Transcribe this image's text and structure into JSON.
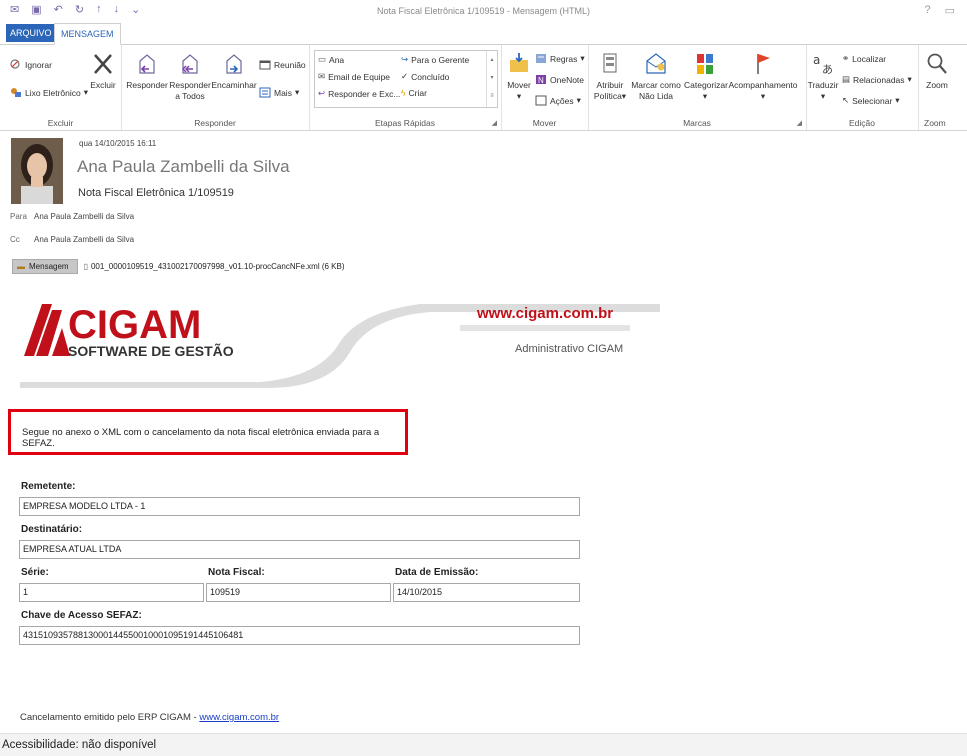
{
  "window": {
    "title": "Nota Fiscal Eletrônica 1/109519 - Mensagem (HTML)"
  },
  "tabs": [
    {
      "label": "ARQUIVO"
    },
    {
      "label": "MENSAGEM"
    }
  ],
  "ribbon": {
    "excluir": {
      "label": "Excluir",
      "ignorar": "Ignorar",
      "lixo": "Lixo Eletrônico",
      "excluir_btn": "Excluir"
    },
    "responder": {
      "label": "Responder",
      "responder_btn": "Responder",
      "responder_todos_1": "Responder",
      "responder_todos_2": "a Todos",
      "encaminhar": "Encaminhar",
      "reuniao": "Reunião",
      "mais": "Mais"
    },
    "etapas": {
      "label": "Etapas Rápidas",
      "items": [
        "Ana",
        "Email de Equipe",
        "Responder e Exc...",
        "Para o Gerente",
        "Concluído",
        "Criar"
      ]
    },
    "mover": {
      "label": "Mover",
      "mover_btn": "Mover",
      "regras": "Regras",
      "onenote": "OneNote",
      "acoes": "Ações"
    },
    "marcas": {
      "label": "Marcas",
      "atribuir_1": "Atribuir",
      "atribuir_2": "Política",
      "marcar_1": "Marcar como",
      "marcar_2": "Não Lida",
      "categorizar": "Categorizar",
      "acompanhamento": "Acompanhamento"
    },
    "edicao": {
      "label": "Edição",
      "traduzir": "Traduzir",
      "localizar": "Localizar",
      "relacionadas": "Relacionadas",
      "selecionar": "Selecionar"
    },
    "zoom": {
      "label": "Zoom",
      "zoom_btn": "Zoom"
    }
  },
  "header": {
    "date": "qua 14/10/2015 16:11",
    "sender": "Ana Paula Zambelli da Silva",
    "subject": "Nota Fiscal Eletrônica 1/109519",
    "para_label": "Para",
    "para_value": "Ana Paula Zambelli da Silva",
    "cc_label": "Cc",
    "cc_value": "Ana Paula Zambelli da Silva",
    "message_tab": "Mensagem",
    "attachment": "001_0000109519_431002170097998_v01.10-procCancNFe.xml (6 KB)"
  },
  "body": {
    "logo_name": "CIGAM",
    "logo_tagline": "SOFTWARE DE GESTÃO",
    "website": "www.cigam.com.br",
    "admin": "Administrativo CIGAM",
    "notice": "Segue no anexo o XML com o cancelamento da nota fiscal eletrônica enviada para a SEFAZ.",
    "remetente_label": "Remetente:",
    "remetente_value": "EMPRESA MODELO LTDA - 1",
    "destinatario_label": "Destinatário:",
    "destinatario_value": "EMPRESA ATUAL LTDA",
    "serie_label": "Série:",
    "serie_value": "1",
    "nota_label": "Nota Fiscal:",
    "nota_value": "109519",
    "emissao_label": "Data de Emissão:",
    "emissao_value": "14/10/2015",
    "chave_label": "Chave de Acesso SEFAZ:",
    "chave_value": "43151093578813000144550010001095191445106481",
    "footer_text": "Cancelamento emitido pelo ERP CIGAM - ",
    "footer_link": "www.cigam.com.br"
  },
  "status": {
    "accessibility": "Acessibilidade: não disponível"
  },
  "colors": {
    "accent": "#2b66b8",
    "brand_red": "#c0101a",
    "highlight_box": "#e0000f"
  }
}
